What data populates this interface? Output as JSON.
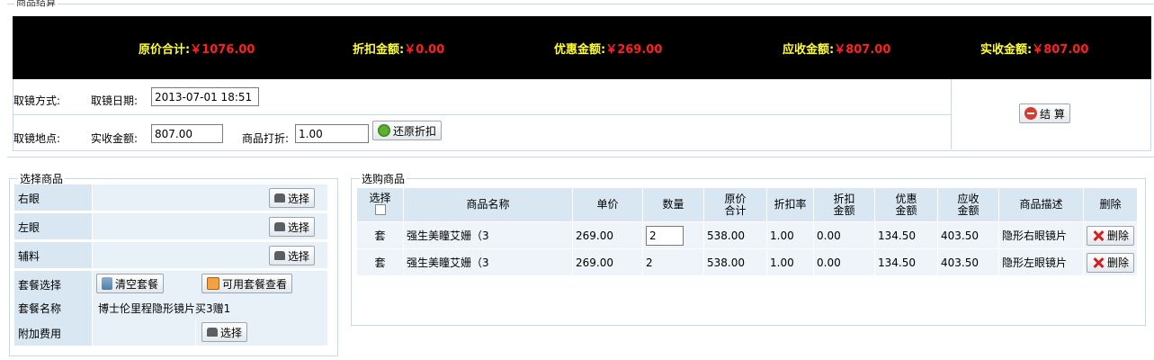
{
  "section_title": "商品结算",
  "summary": [
    {
      "label": "原价合计:",
      "value": "￥1076.00"
    },
    {
      "label": "折扣金额:",
      "value": "￥0.00"
    },
    {
      "label": "优惠金额:",
      "value": "￥269.00"
    },
    {
      "label": "应收金额:",
      "value": "￥807.00"
    },
    {
      "label": "实收金额:",
      "value": "￥807.00"
    }
  ],
  "form": {
    "pickup_method_label": "取镜方式:",
    "pickup_date_label": "取镜日期:",
    "pickup_date_value": "2013-07-01 18:51",
    "pickup_place_label": "取镜地点:",
    "paid_amount_label": "实收金额:",
    "paid_amount_value": "807.00",
    "discount_label": "商品打折:",
    "discount_value": "1.00",
    "restore_button": "还原折扣",
    "checkout_button": "结 算"
  },
  "select_panel": {
    "title": "选择商品",
    "right_eye_label": "右眼",
    "left_eye_label": "左眼",
    "accessory_label": "辅料",
    "package_select_label": "套餐选择",
    "package_name_label": "套餐名称",
    "package_name_value": "博士伦里程隐形镜片买3赠1",
    "extra_fee_label": "附加费用",
    "select_button": "选择",
    "clear_package_button": "清空套餐",
    "view_package_button": "可用套餐查看"
  },
  "cart_panel": {
    "title": "选购商品",
    "columns": {
      "select_line1": "选择",
      "name": "商品名称",
      "unit_price": "单价",
      "quantity": "数量",
      "orig_total_l1": "原价",
      "orig_total_l2": "合计",
      "discount_rate": "折扣率",
      "discount_amt_l1": "折扣",
      "discount_amt_l2": "金额",
      "promo_amt_l1": "优惠",
      "promo_amt_l2": "金额",
      "receivable_l1": "应收",
      "receivable_l2": "金额",
      "desc": "商品描述",
      "delete": "删除"
    },
    "rows": [
      {
        "select": "套",
        "name": "强生美瞳艾姗（3",
        "unit_price": "269.00",
        "quantity": "2",
        "orig_total": "538.00",
        "discount_rate": "1.00",
        "discount_amt": "0.00",
        "promo_amt": "134.50",
        "receivable": "403.50",
        "desc": "隐形右眼镜片",
        "delete": "删除"
      },
      {
        "select": "套",
        "name": "强生美瞳艾姗（3",
        "unit_price": "269.00",
        "quantity": "2",
        "orig_total": "538.00",
        "discount_rate": "1.00",
        "discount_amt": "0.00",
        "promo_amt": "134.50",
        "receivable": "403.50",
        "desc": "隐形左眼镜片",
        "delete": "删除"
      }
    ]
  },
  "colors": {
    "summary_bg": "#000000",
    "summary_label": "#ffff33",
    "summary_value": "#ff2020",
    "cell_header": "#d9e7f2",
    "cell_body": "#eef4f9"
  }
}
